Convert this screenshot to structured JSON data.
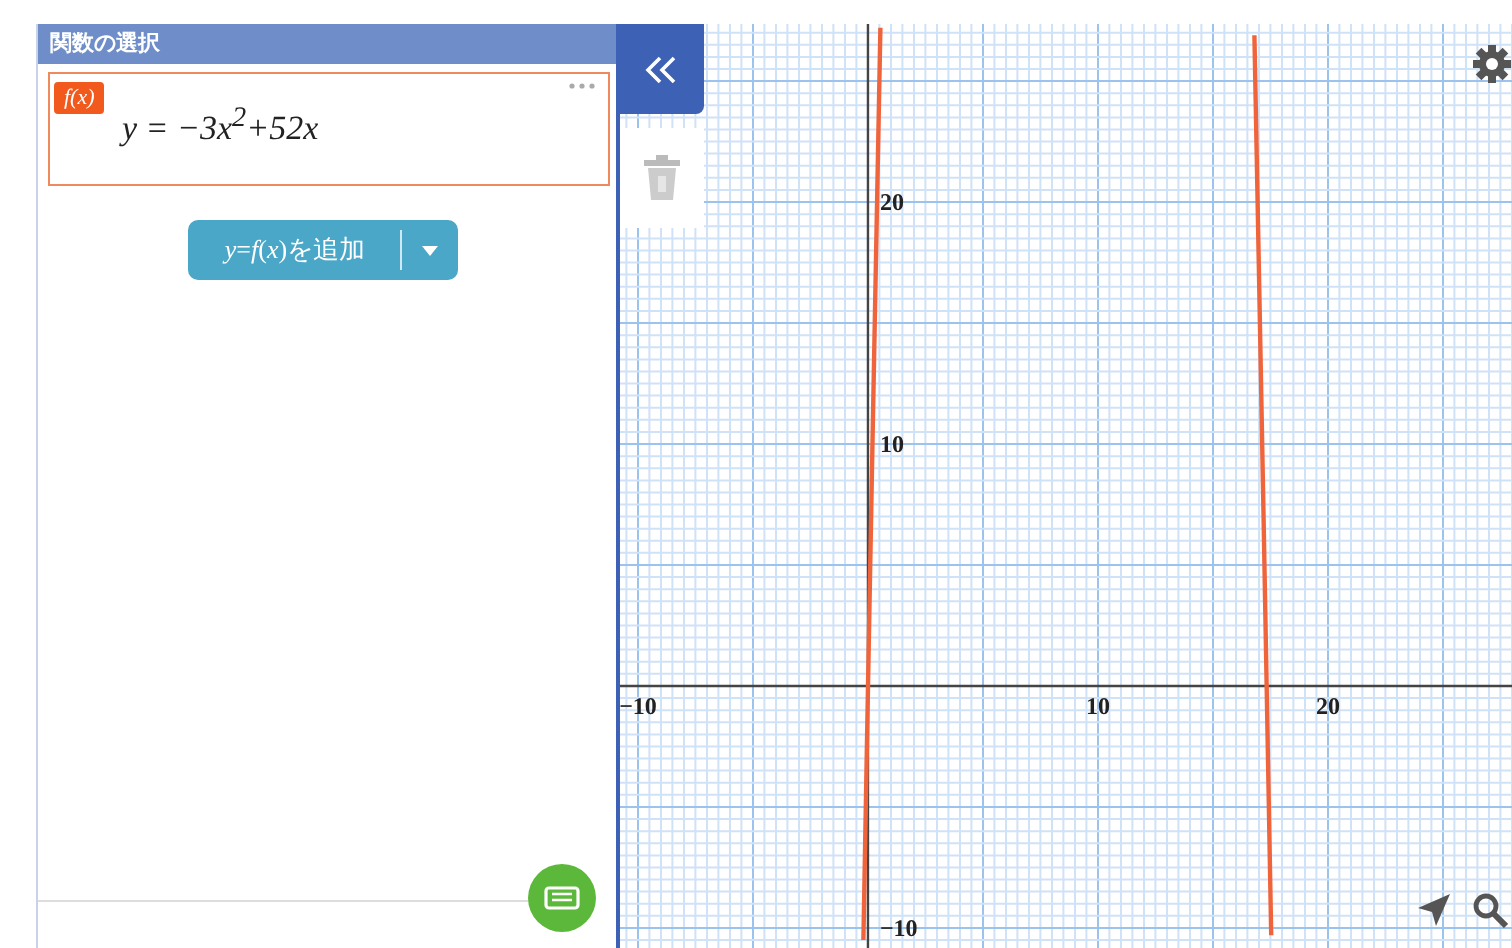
{
  "panel": {
    "title": "関数の選択",
    "expressions": [
      {
        "badge": "f(x)",
        "formula": "y = −3x$^{2}$+52x",
        "selected": true
      }
    ],
    "add_button": {
      "label": "*y*=*f*(*x*)を追加"
    }
  },
  "graph": {
    "chart_data": {
      "type": "line",
      "grid": true,
      "x": [
        -0.2,
        0,
        0.2,
        0.4,
        0.54,
        8.67,
        16.8,
        17,
        17.2,
        17.4,
        17.53
      ],
      "series": [
        {
          "color": "#f0643c",
          "values": [
            -10.5,
            0,
            10.3,
            20.3,
            27.2,
            null,
            26.9,
            17,
            6.9,
            -3.5,
            -10.3
          ]
        }
      ],
      "xlim": [
        -10.78,
        28
      ],
      "ylim": [
        -10.83,
        27.36
      ],
      "xticks": [
        {
          "value": -10,
          "label": "−10"
        },
        10,
        20
      ],
      "yticks": [
        {
          "value": -10,
          "label": "−10"
        },
        10,
        20
      ]
    }
  }
}
